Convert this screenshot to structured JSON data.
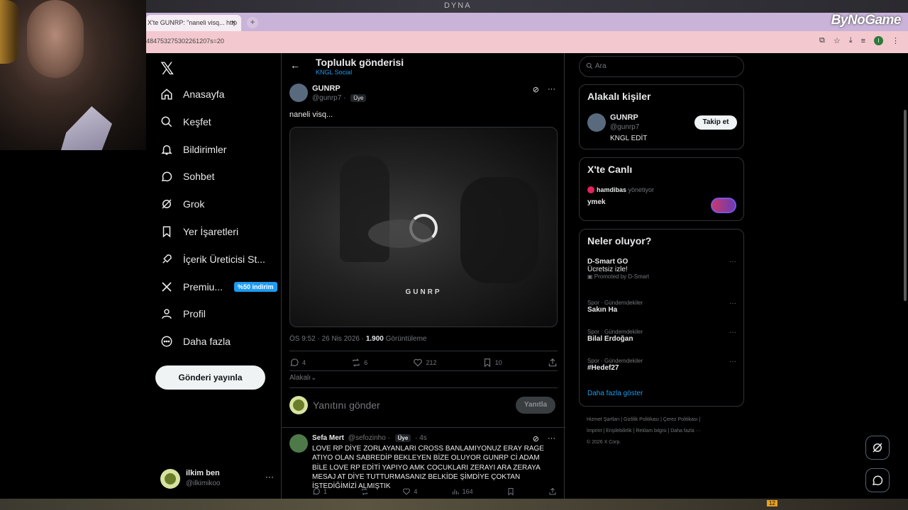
{
  "browser": {
    "tab_title": "X'te GUNRP: \"naneli visq... http",
    "tab_close": "×",
    "new_tab": "+",
    "url": "484753275302261207s=20",
    "watermark": "ByNoGame",
    "profile_initial": "I"
  },
  "desktop": {
    "top_text": "DYNA"
  },
  "nav": {
    "items": [
      {
        "label": "Anasayfa",
        "icon": "home-icon"
      },
      {
        "label": "Keşfet",
        "icon": "search-icon"
      },
      {
        "label": "Bildirimler",
        "icon": "bell-icon"
      },
      {
        "label": "Sohbet",
        "icon": "chat-icon"
      },
      {
        "label": "Grok",
        "icon": "grok-icon"
      },
      {
        "label": "Yer İşaretleri",
        "icon": "bookmark-icon"
      },
      {
        "label": "İçerik Üreticisi St...",
        "icon": "rocket-icon"
      },
      {
        "label": "Premiu...",
        "icon": "x-icon"
      },
      {
        "label": "Profil",
        "icon": "person-icon"
      },
      {
        "label": "Daha fazla",
        "icon": "more-circle-icon"
      }
    ],
    "premium_badge": "%50 indirim",
    "post_button": "Gönderi yayınla",
    "me": {
      "name": "ilkim ben",
      "handle": "@ilkimikoo"
    }
  },
  "header": {
    "title": "Topluluk gönderisi",
    "subtitle": "KNGL Social"
  },
  "post": {
    "name": "GUNRP",
    "handle": "@gunrp7 ·",
    "badge": "Üye",
    "text": "naneli visq...",
    "media_watermark": "GUNRP",
    "time": "ÖS 9:52 · 26 Nis 2026 ·",
    "views": "1.900",
    "views_label": "Görüntüleme",
    "replies": "4",
    "reposts": "6",
    "likes": "212",
    "bookmarks": "10",
    "sort": "Alakalı"
  },
  "reply_box": {
    "placeholder": "Yanıtını gönder",
    "button": "Yanıtla"
  },
  "comment": {
    "name": "Sefa Mert",
    "handle": "@sefozinho ·",
    "badge": "Üye",
    "time": "· 4s",
    "text": "LOVE RP DİYE ZORLAYANLARI CROSS BANLAMIYONUZ ERAY RAGE ATIYO OLAN SABREDİP BEKLEYEN BİZE OLUYOR GUNRP Cİ ADAM BİLE LOVE RP EDİTİ YAPIYO AMK COCUKLARI ZERAYI ARA ZERAYA MESAJ AT DİYE TUTTURMASANIZ BELKİDE ŞİMDİYE ÇOKTAN İSTEDİĞİMİZİ ALMIŞTIK",
    "replies": "1",
    "likes": "4",
    "views": "164"
  },
  "right": {
    "search_placeholder": "Ara",
    "related_title": "Alakalı kişiler",
    "related": {
      "name": "GUNRP",
      "handle": "@gunrp7",
      "bio": "KNGL EDİT",
      "follow": "Takip et"
    },
    "live_title": "X'te Canlı",
    "live": {
      "host": "hamdibas",
      "role": "yönetiyor",
      "title": "ymek"
    },
    "trends_title": "Neler oluyor?",
    "trends": [
      {
        "category": "",
        "title": "D-Smart GO",
        "sub": "Ücretsiz izle!",
        "promo": "Promoted by D-Smart"
      },
      {
        "category": "Spor · Gündemdekiler",
        "title": "Sakın Ha",
        "sub": "",
        "promo": ""
      },
      {
        "category": "Spor · Gündemdekiler",
        "title": "Bilal Erdoğan",
        "sub": "",
        "promo": ""
      },
      {
        "category": "Spor · Gündemdekiler",
        "title": "#Hedef27",
        "sub": "",
        "promo": ""
      }
    ],
    "show_more": "Daha fazla göster",
    "footer_line1": "Hizmet Şartları  |  Gizlilik Politikası  |  Çerez Politikası  |",
    "footer_line2": "İmprint  |  Erişilebilirlik  |  Reklam bilgisi  |  Daha fazla ···",
    "footer_line3": "© 2026 X Corp."
  },
  "taskbar": {
    "badge": "12"
  },
  "accent_color": "#1d9bf0"
}
